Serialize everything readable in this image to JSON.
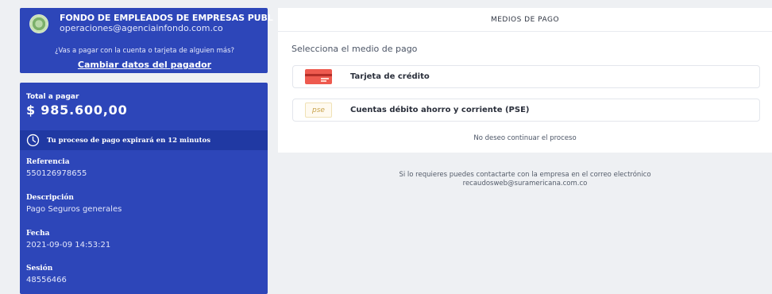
{
  "payer": {
    "company_name": "FONDO DE EMPLEADOS DE EMPRESAS PUBL",
    "company_email": "operaciones@agenciainfondo.com.co",
    "question": "¿Vas a pagar con la cuenta o tarjeta de alguien más?",
    "change_link": "Cambiar datos del pagador"
  },
  "summary": {
    "total_label": "Total a pagar",
    "total_amount": "$ 985.600,00",
    "expire_text": "Tu proceso de pago expirará en 12 minutos",
    "fields": [
      {
        "label": "Referencia",
        "value": "550126978655"
      },
      {
        "label": "Descripción",
        "value": "Pago Seguros generales"
      },
      {
        "label": "Fecha",
        "value": "2021-09-09 14:53:21"
      },
      {
        "label": "Sesión",
        "value": "48556466"
      }
    ]
  },
  "panel": {
    "title": "MEDIOS DE PAGO",
    "prompt": "Selecciona el medio de pago",
    "methods": [
      {
        "label": "Tarjeta de crédito",
        "icon": "credit-card-icon"
      },
      {
        "label": "Cuentas débito ahorro y corriente (PSE)",
        "icon": "pse-icon",
        "icon_text": "pse"
      }
    ],
    "cancel": "No deseo continuar el proceso"
  },
  "contact": {
    "line1": "Si lo requieres puedes contactarte con la empresa en el correo electrónico",
    "line2": "recaudosweb@suramericana.com.co"
  },
  "colors": {
    "sidebar_blue": "#2d46b9",
    "expire_bar": "#2039a3",
    "background": "#eef0f3"
  }
}
